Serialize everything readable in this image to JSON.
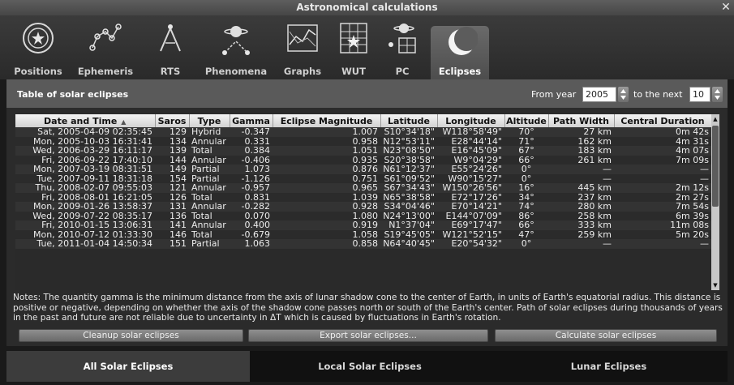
{
  "window": {
    "title": "Astronomical calculations",
    "close_glyph": "✕"
  },
  "tabs": [
    {
      "label": "Positions",
      "icon": "positions-icon"
    },
    {
      "label": "Ephemeris",
      "icon": "ephemeris-icon"
    },
    {
      "label": "RTS",
      "icon": "rts-icon"
    },
    {
      "label": "Phenomena",
      "icon": "phenomena-icon"
    },
    {
      "label": "Graphs",
      "icon": "graphs-icon"
    },
    {
      "label": "WUT",
      "icon": "wut-icon"
    },
    {
      "label": "PC",
      "icon": "pc-icon"
    },
    {
      "label": "Eclipses",
      "icon": "eclipses-icon",
      "active": true
    }
  ],
  "panel": {
    "title": "Table of solar eclipses",
    "from_year_label": "From year",
    "from_year_value": "2005",
    "to_next_label": "to the next",
    "to_next_value": "10"
  },
  "table": {
    "columns": [
      "Date and Time",
      "Saros",
      "Type",
      "Gamma",
      "Eclipse Magnitude",
      "Latitude",
      "Longitude",
      "Altitude",
      "Path Width",
      "Central Duration"
    ],
    "sort_indicator": "▲",
    "rows": [
      [
        "Sat, 2005-04-09 02:35:45",
        "129",
        "Hybrid",
        "-0.347",
        "1.007",
        "S10°34'18\"",
        "W118°58'49\"",
        "70°",
        "27 km",
        "0m 42s"
      ],
      [
        "Mon, 2005-10-03 16:31:41",
        "134",
        "Annular",
        "0.331",
        "0.958",
        "N12°53'11\"",
        "E28°44'14\"",
        "71°",
        "162 km",
        "4m 31s"
      ],
      [
        "Wed, 2006-03-29 16:11:17",
        "139",
        "Total",
        "0.384",
        "1.051",
        "N23°08'50\"",
        "E16°45'09\"",
        "67°",
        "183 km",
        "4m 07s"
      ],
      [
        "Fri, 2006-09-22 17:40:10",
        "144",
        "Annular",
        "-0.406",
        "0.935",
        "S20°38'58\"",
        "W9°04'29\"",
        "66°",
        "261 km",
        "7m 09s"
      ],
      [
        "Mon, 2007-03-19 08:31:51",
        "149",
        "Partial",
        "1.073",
        "0.876",
        "N61°12'37\"",
        "E55°24'26\"",
        "0°",
        "—",
        "—"
      ],
      [
        "Tue, 2007-09-11 18:31:18",
        "154",
        "Partial",
        "-1.126",
        "0.751",
        "S61°09'52\"",
        "W90°15'27\"",
        "0°",
        "—",
        "—"
      ],
      [
        "Thu, 2008-02-07 09:55:03",
        "121",
        "Annular",
        "-0.957",
        "0.965",
        "S67°34'43\"",
        "W150°26'56\"",
        "16°",
        "445 km",
        "2m 12s"
      ],
      [
        "Fri, 2008-08-01 16:21:05",
        "126",
        "Total",
        "0.831",
        "1.039",
        "N65°38'58\"",
        "E72°17'26\"",
        "34°",
        "237 km",
        "2m 27s"
      ],
      [
        "Mon, 2009-01-26 13:58:37",
        "131",
        "Annular",
        "-0.282",
        "0.928",
        "S34°04'46\"",
        "E70°14'21\"",
        "74°",
        "280 km",
        "7m 54s"
      ],
      [
        "Wed, 2009-07-22 08:35:17",
        "136",
        "Total",
        "0.070",
        "1.080",
        "N24°13'00\"",
        "E144°07'09\"",
        "86°",
        "258 km",
        "6m 39s"
      ],
      [
        "Fri, 2010-01-15 13:06:31",
        "141",
        "Annular",
        "0.400",
        "0.919",
        "N1°37'04\"",
        "E69°17'47\"",
        "66°",
        "333 km",
        "11m 08s"
      ],
      [
        "Mon, 2010-07-12 01:33:30",
        "146",
        "Total",
        "-0.679",
        "1.058",
        "S19°45'05\"",
        "W121°52'15\"",
        "47°",
        "259 km",
        "5m 20s"
      ],
      [
        "Tue, 2011-01-04 14:50:34",
        "151",
        "Partial",
        "1.063",
        "0.858",
        "N64°40'45\"",
        "E20°54'32\"",
        "0°",
        "—",
        "—"
      ]
    ]
  },
  "notes": "Notes: The quantity gamma is the minimum distance from the axis of lunar shadow cone to the center of Earth, in units of Earth's equatorial radius. This distance is positive or negative, depending on whether the axis of the shadow cone passes north or south of the Earth's center. Path of solar eclipses during thousands of years in the past and future are not reliable due to uncertainty in ΔT which is caused by fluctuations in Earth's rotation.",
  "buttons": {
    "cleanup": "Cleanup solar eclipses",
    "export": "Export solar eclipses...",
    "calculate": "Calculate solar eclipses"
  },
  "bottom_tabs": {
    "all": "All Solar Eclipses",
    "local": "Local Solar Eclipses",
    "lunar": "Lunar Eclipses"
  }
}
